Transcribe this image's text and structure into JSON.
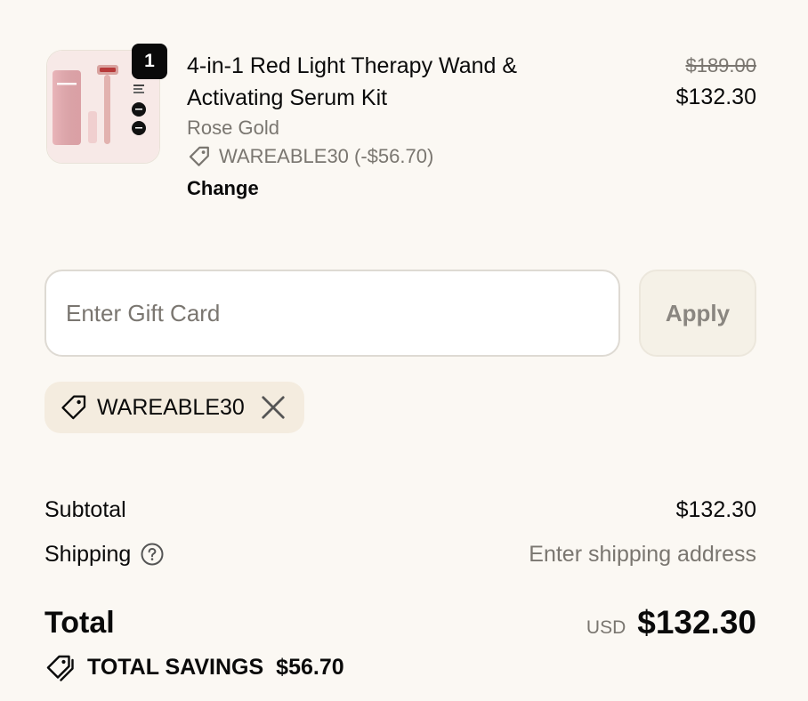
{
  "colors": {
    "background": "#FBF8F3",
    "text": "#0A0A0A",
    "muted_text": "#7A7670",
    "chip_background": "#F4ECDF",
    "apply_background": "#F5F1E7"
  },
  "line_item": {
    "quantity": "1",
    "title": "4-in-1 Red Light Therapy Wand & Activating Serum Kit",
    "variant": "Rose Gold",
    "discount_icon": "tag-icon",
    "discount": "WAREABLE30 (-$56.70)",
    "change_label": "Change",
    "original_price": "$189.00",
    "price": "$132.30"
  },
  "gift_card": {
    "placeholder": "Enter Gift Card",
    "value": "",
    "apply_label": "Apply"
  },
  "applied_discount": {
    "icon": "tag-icon",
    "code": "WAREABLE30",
    "remove_icon": "close-icon"
  },
  "summary": {
    "subtotal_label": "Subtotal",
    "subtotal_value": "$132.30",
    "shipping_label": "Shipping",
    "shipping_help_icon": "question-circle-icon",
    "shipping_value": "Enter shipping address",
    "total_label": "Total",
    "currency": "USD",
    "total_value": "$132.30",
    "savings_icon": "tags-icon",
    "savings_label": "TOTAL SAVINGS",
    "savings_value": "$56.70"
  }
}
